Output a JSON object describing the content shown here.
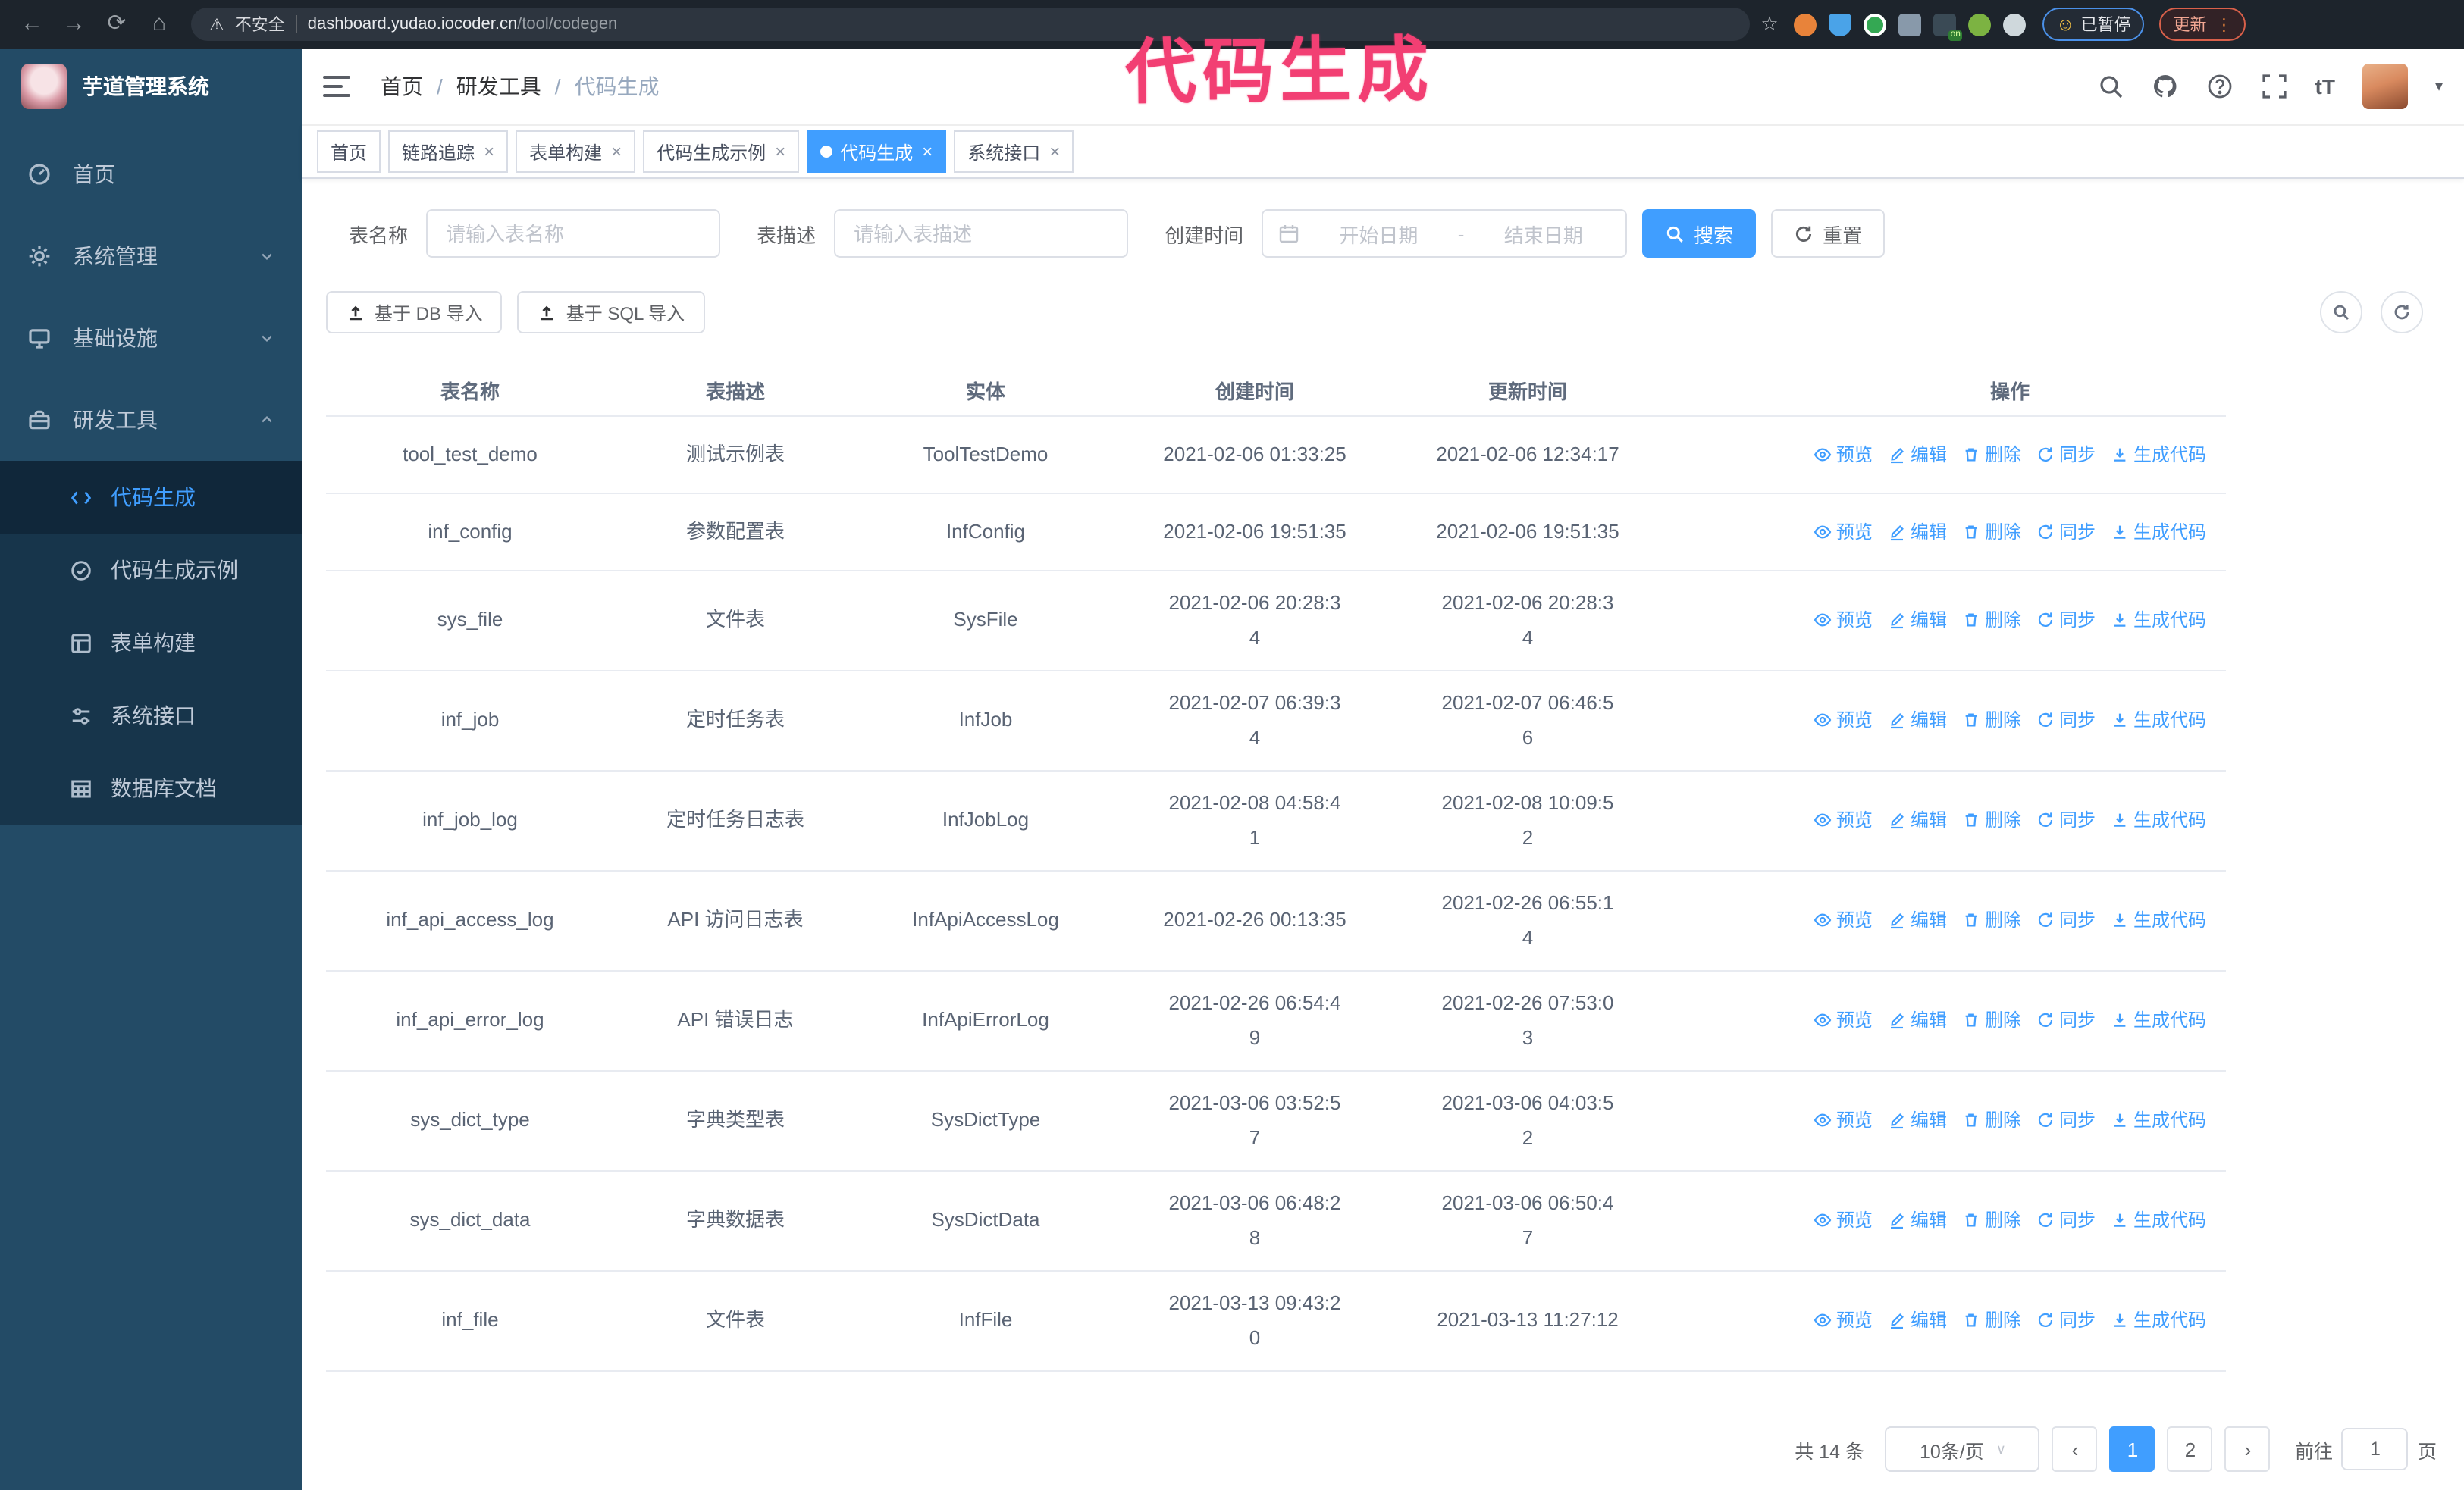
{
  "glyphs": {
    "back": "←",
    "forward": "→",
    "reload": "⟳",
    "home": "⌂",
    "warn": "⚠",
    "star": "☆",
    "dots": "⋮",
    "smile": "☺",
    "on_badge": "on",
    "close": "×",
    "caret": "▾",
    "select_caret": "∨",
    "prev": "‹",
    "next": "›",
    "breadcrumb_sep": "/",
    "fontsize": "tT"
  },
  "browser": {
    "security_label": "不安全",
    "url_host": "dashboard.yudao.iocoder.cn",
    "url_path": "/tool/codegen",
    "paused_badge": "已暂停",
    "update_button": "更新"
  },
  "annotation": {
    "text": "代码生成",
    "color": "#f23f73"
  },
  "sidebar": {
    "app_title": "芋道管理系统",
    "items": [
      {
        "label": "首页"
      },
      {
        "label": "系统管理",
        "chevron": "down"
      },
      {
        "label": "基础设施",
        "chevron": "down"
      },
      {
        "label": "研发工具",
        "chevron": "up"
      }
    ],
    "subitems": [
      {
        "label": "代码生成",
        "active": true
      },
      {
        "label": "代码生成示例"
      },
      {
        "label": "表单构建"
      },
      {
        "label": "系统接口"
      },
      {
        "label": "数据库文档"
      }
    ]
  },
  "topbar": {
    "breadcrumb": [
      "首页",
      "研发工具",
      "代码生成"
    ]
  },
  "tabs": [
    {
      "label": "首页",
      "closable": false
    },
    {
      "label": "链路追踪",
      "closable": true
    },
    {
      "label": "表单构建",
      "closable": true
    },
    {
      "label": "代码生成示例",
      "closable": true
    },
    {
      "label": "代码生成",
      "closable": true,
      "active": true
    },
    {
      "label": "系统接口",
      "closable": true
    }
  ],
  "search": {
    "name_label": "表名称",
    "name_placeholder": "请输入表名称",
    "desc_label": "表描述",
    "desc_placeholder": "请输入表描述",
    "date_label": "创建时间",
    "date_start_placeholder": "开始日期",
    "date_separator": "-",
    "date_end_placeholder": "结束日期",
    "search_button": "搜索",
    "reset_button": "重置"
  },
  "toolbar": {
    "import_db": "基于 DB 导入",
    "import_sql": "基于 SQL 导入"
  },
  "table": {
    "columns": [
      "表名称",
      "表描述",
      "实体",
      "创建时间",
      "更新时间",
      "操作"
    ],
    "actions": [
      {
        "label": "预览"
      },
      {
        "label": "编辑"
      },
      {
        "label": "删除"
      },
      {
        "label": "同步"
      },
      {
        "label": "生成代码"
      }
    ],
    "rows": [
      {
        "name": "tool_test_demo",
        "desc": "测试示例表",
        "entity": "ToolTestDemo",
        "created": "2021-02-06 01:33:25",
        "updated": "2021-02-06 12:34:17",
        "tall": false
      },
      {
        "name": "inf_config",
        "desc": "参数配置表",
        "entity": "InfConfig",
        "created": "2021-02-06 19:51:35",
        "updated": "2021-02-06 19:51:35",
        "tall": false
      },
      {
        "name": "sys_file",
        "desc": "文件表",
        "entity": "SysFile",
        "created": "2021-02-06 20:28:3\n4",
        "updated": "2021-02-06 20:28:3\n4",
        "tall": true
      },
      {
        "name": "inf_job",
        "desc": "定时任务表",
        "entity": "InfJob",
        "created": "2021-02-07 06:39:3\n4",
        "updated": "2021-02-07 06:46:5\n6",
        "tall": true
      },
      {
        "name": "inf_job_log",
        "desc": "定时任务日志表",
        "entity": "InfJobLog",
        "created": "2021-02-08 04:58:4\n1",
        "updated": "2021-02-08 10:09:5\n2",
        "tall": true
      },
      {
        "name": "inf_api_access_log",
        "desc": "API 访问日志表",
        "entity": "InfApiAccessLog",
        "created": "2021-02-26 00:13:35",
        "updated": "2021-02-26 06:55:1\n4",
        "tall": true
      },
      {
        "name": "inf_api_error_log",
        "desc": "API 错误日志",
        "entity": "InfApiErrorLog",
        "created": "2021-02-26 06:54:4\n9",
        "updated": "2021-02-26 07:53:0\n3",
        "tall": true
      },
      {
        "name": "sys_dict_type",
        "desc": "字典类型表",
        "entity": "SysDictType",
        "created": "2021-03-06 03:52:5\n7",
        "updated": "2021-03-06 04:03:5\n2",
        "tall": true
      },
      {
        "name": "sys_dict_data",
        "desc": "字典数据表",
        "entity": "SysDictData",
        "created": "2021-03-06 06:48:2\n8",
        "updated": "2021-03-06 06:50:4\n7",
        "tall": true
      },
      {
        "name": "inf_file",
        "desc": "文件表",
        "entity": "InfFile",
        "created": "2021-03-13 09:43:2\n0",
        "updated": "2021-03-13 11:27:12",
        "tall": true
      }
    ]
  },
  "pagination": {
    "total": "共 14 条",
    "page_size": "10条/页",
    "pages": [
      "1",
      "2"
    ],
    "goto_label": "前往",
    "goto_value": "1",
    "goto_suffix": "页"
  },
  "colors": {
    "accent": "#409eff",
    "sidebar_bg": "#234b66",
    "submenu_bg": "#17354b",
    "annotation_pink": "#f23f73",
    "browser_bar": "#1d242c"
  }
}
